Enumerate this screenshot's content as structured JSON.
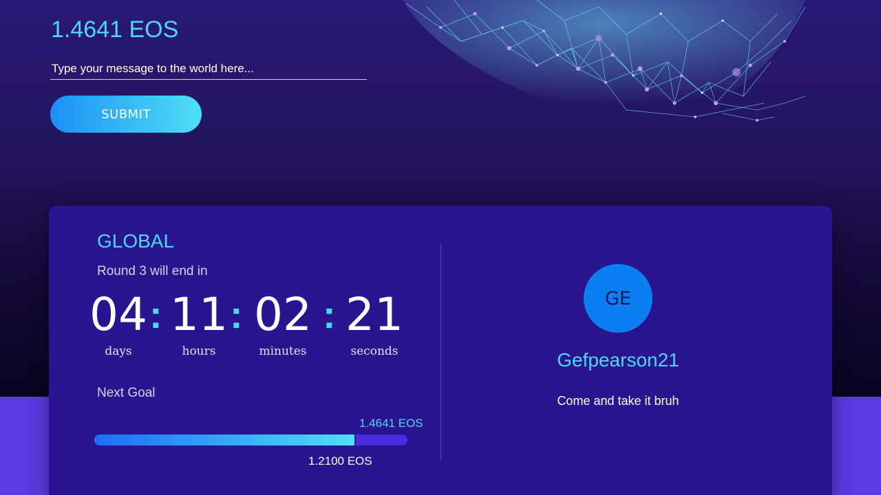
{
  "header": {
    "balance": "1.4641 EOS",
    "message_placeholder": "Type your message to the world here...",
    "submit_label": "SUBMIT"
  },
  "global": {
    "title": "GLOBAL",
    "round_text": "Round 3 will end in",
    "countdown": {
      "days": "04",
      "hours": "11",
      "minutes": "02",
      "seconds": "21",
      "separator": ":",
      "days_label": "days",
      "hours_label": "hours",
      "minutes_label": "minutes",
      "seconds_label": "seconds"
    },
    "next_goal_label": "Next Goal",
    "goal_current": "1.4641 EOS",
    "goal_target": "1.2100 EOS",
    "progress_fraction": 0.835
  },
  "leader": {
    "initials": "GE",
    "name": "Gefpearson21",
    "message": "Come and take it bruh"
  },
  "colors": {
    "accent": "#4fd8f5",
    "card": "#2b1490",
    "band": "#5b3adf",
    "avatar": "#0a7ff2"
  }
}
